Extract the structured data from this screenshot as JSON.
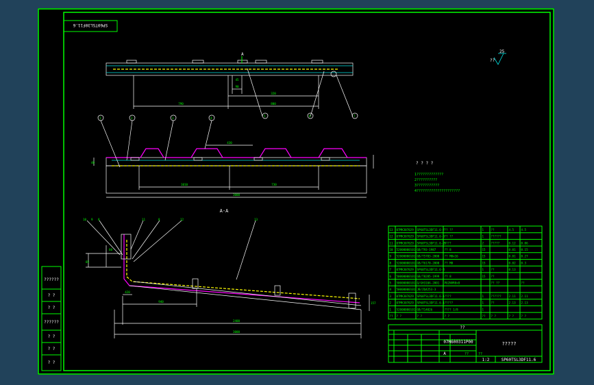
{
  "drawing": {
    "stamp_mirrored": "SP60TSL30F11.6",
    "drawing_no": "SP60TSL3DF11.6",
    "section_label": "A-A",
    "roughness": "25",
    "roughness_prefix": "??",
    "view_mark": "A"
  },
  "dimensions": {
    "top_left": "790",
    "top_mid": "320",
    "top_right": "800",
    "top_small1": "90",
    "top_small2": "45",
    "mid_top": "430",
    "mid_left": "1010",
    "mid_right": "730",
    "mid_total": "3000",
    "mid_height": "40",
    "bot_a": "420",
    "bot_b": "940",
    "bot_c": "3000",
    "bot_d": "2400",
    "bot_h": "85",
    "bot_v": "60",
    "bot_e": "157"
  },
  "balloons": {
    "top": [
      "4",
      "5",
      "6",
      "7"
    ],
    "mid": [
      "1",
      "2",
      "3",
      "4"
    ],
    "bot": [
      "10",
      "9",
      "8",
      "11",
      "8",
      "12",
      "13"
    ]
  },
  "notes": {
    "title": "? ? ? ?",
    "lines": [
      "1?????????????",
      "2??????????",
      "3???????????",
      "4?????????????????????"
    ]
  },
  "bom": {
    "rows": [
      [
        "13",
        "07MK307029",
        "SP60TSL3DF11.6-7",
        "?? ??",
        "1",
        "??",
        "4.5",
        "4.5"
      ],
      [
        "12",
        "07MK307029",
        "SP60TSL3DF11.6-3",
        "?? ??",
        "1",
        "??????",
        "",
        ""
      ],
      [
        "11",
        "07MK307029",
        "SP60TSL3DF11.6-2",
        "B???",
        "2",
        "?????",
        "0.12",
        "0.06"
      ],
      [
        "10",
        "52000000101",
        "GB/T93-1987",
        "?? 8",
        "15",
        "",
        "0.01",
        "0.15"
      ],
      [
        "9",
        "52000000101",
        "GB/T5783-2000",
        "?? M8x16",
        "15",
        "",
        "0.01",
        "0.27"
      ],
      [
        "8",
        "52000000101",
        "GB/T6170-2000",
        "?? M8",
        "15",
        "",
        "0.02",
        "0.3"
      ],
      [
        "7",
        "07MK307029",
        "SP60TSL3DF11.6-4",
        "",
        "1",
        "??",
        "0.13",
        ""
      ],
      [
        "6",
        "50000000101",
        "GB/T8285-1999",
        "?? 8",
        "15",
        "??",
        "",
        ""
      ],
      [
        "5",
        "50000000101",
        "Q/GH310A-2001",
        "PU2NVR8x8",
        "",
        "?? ??",
        "",
        "??"
      ],
      [
        "4",
        "50000000101",
        "JB/ZQ4253-3",
        "",
        "",
        "",
        "",
        ""
      ],
      [
        "3",
        "07MK307029",
        "SP60TSL3DF11.6-1",
        "????",
        "1",
        "??????",
        "2.11",
        "2.11"
      ],
      [
        "2",
        "07MK307029",
        "SP60TSL3DF11.6-1",
        "?????",
        "1",
        "??",
        "2.13",
        "2.13"
      ],
      [
        "1",
        "52000000101",
        "GB/T14026",
        "???? 1/8",
        "1",
        "",
        "",
        ""
      ]
    ],
    "header": [
      "??",
      "? ?",
      "? ?",
      "? ?",
      "??",
      "? ?",
      "? ?",
      "? ?"
    ]
  },
  "title_block": {
    "label_material": "??",
    "label_number": "07M600311P00",
    "product_name": "?????",
    "drawing_no": "SP60TSL3DF11.6",
    "stage": "A",
    "scale_label": "??",
    "scale": "1:2",
    "weight_label": "??"
  },
  "side_block": {
    "cells": [
      "??????",
      "? ?",
      "? ?",
      "??????",
      "? ?",
      "? ?",
      "? ?"
    ]
  }
}
